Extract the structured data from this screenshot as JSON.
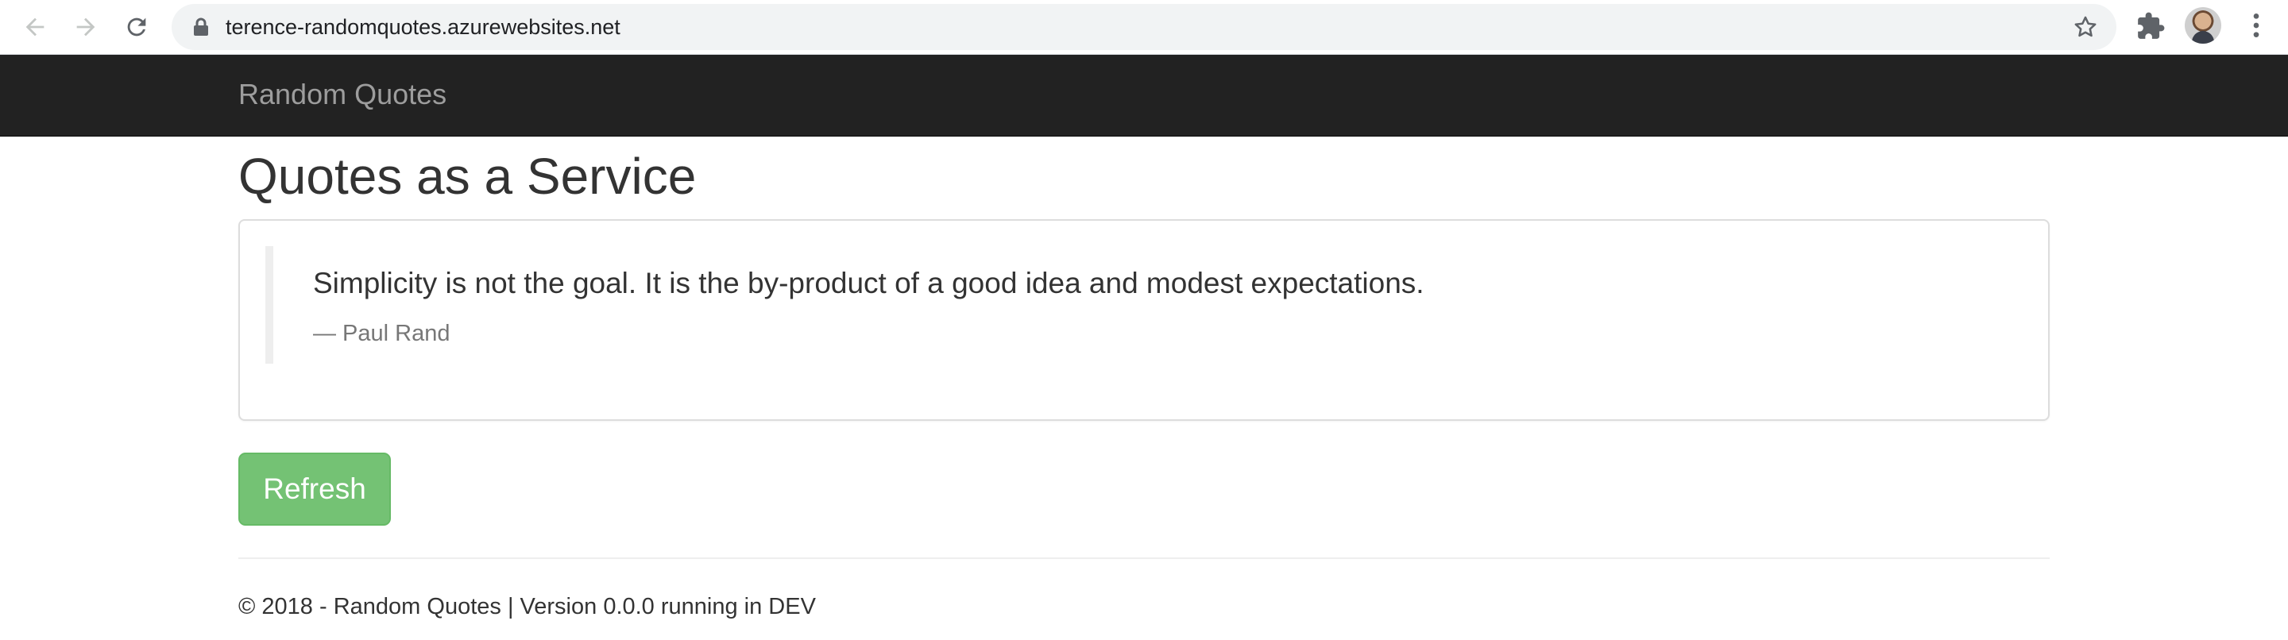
{
  "browser": {
    "url": "terence-randomquotes.azurewebsites.net",
    "icons": [
      "back-arrow-icon",
      "forward-arrow-icon",
      "reload-icon",
      "lock-icon",
      "star-icon",
      "puzzle-icon",
      "avatar",
      "more-vert-icon"
    ]
  },
  "navbar": {
    "brand": "Random Quotes",
    "background": "#222222",
    "brand_color": "#9d9d9d"
  },
  "main": {
    "title": "Quotes as a Service",
    "quote": {
      "text": "Simplicity is not the goal. It is the by-product of a good idea and modest expectations.",
      "author": "— Paul Rand"
    },
    "refresh_label": "Refresh",
    "refresh_color": "#5cb85c"
  },
  "footer": {
    "text": "© 2018 - Random Quotes | Version 0.0.0 running in DEV"
  }
}
